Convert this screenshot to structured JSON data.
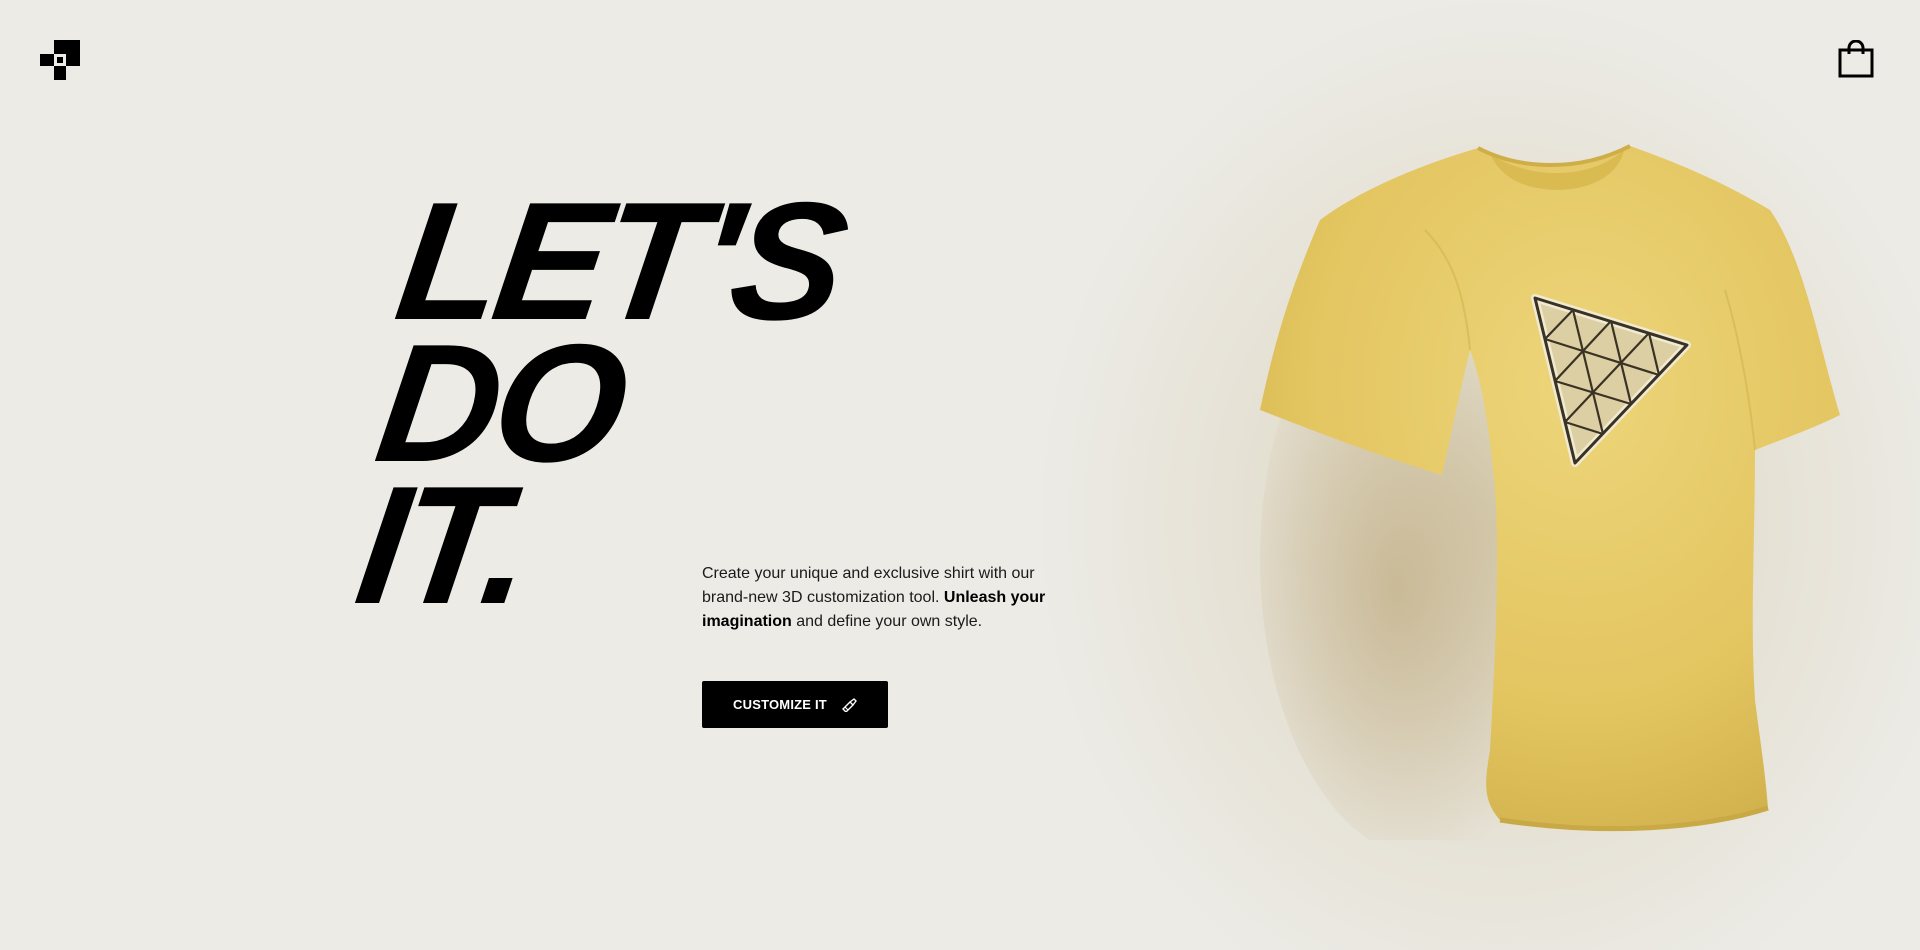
{
  "header": {
    "logo_icon": "blocks-logo-icon",
    "cart_icon": "shopping-bag-icon"
  },
  "hero": {
    "headline_line1": "LET'S",
    "headline_line2": "DO",
    "headline_line3": "IT.",
    "description_part1": "Create your unique and exclusive shirt with our brand-new 3D customization tool. ",
    "description_bold": "Unleash your imagination",
    "description_part2": " and define your own style.",
    "cta_label": "CUSTOMIZE IT",
    "cta_icon": "paint-brush-icon"
  },
  "product": {
    "image": "yellow-tshirt-with-triangle-decal",
    "shirt_color": "#e8cd6a",
    "decal_color": "#dccfa4"
  },
  "colors": {
    "background": "#ecebe6",
    "text": "#000000",
    "button_bg": "#000000",
    "button_text": "#ffffff"
  }
}
